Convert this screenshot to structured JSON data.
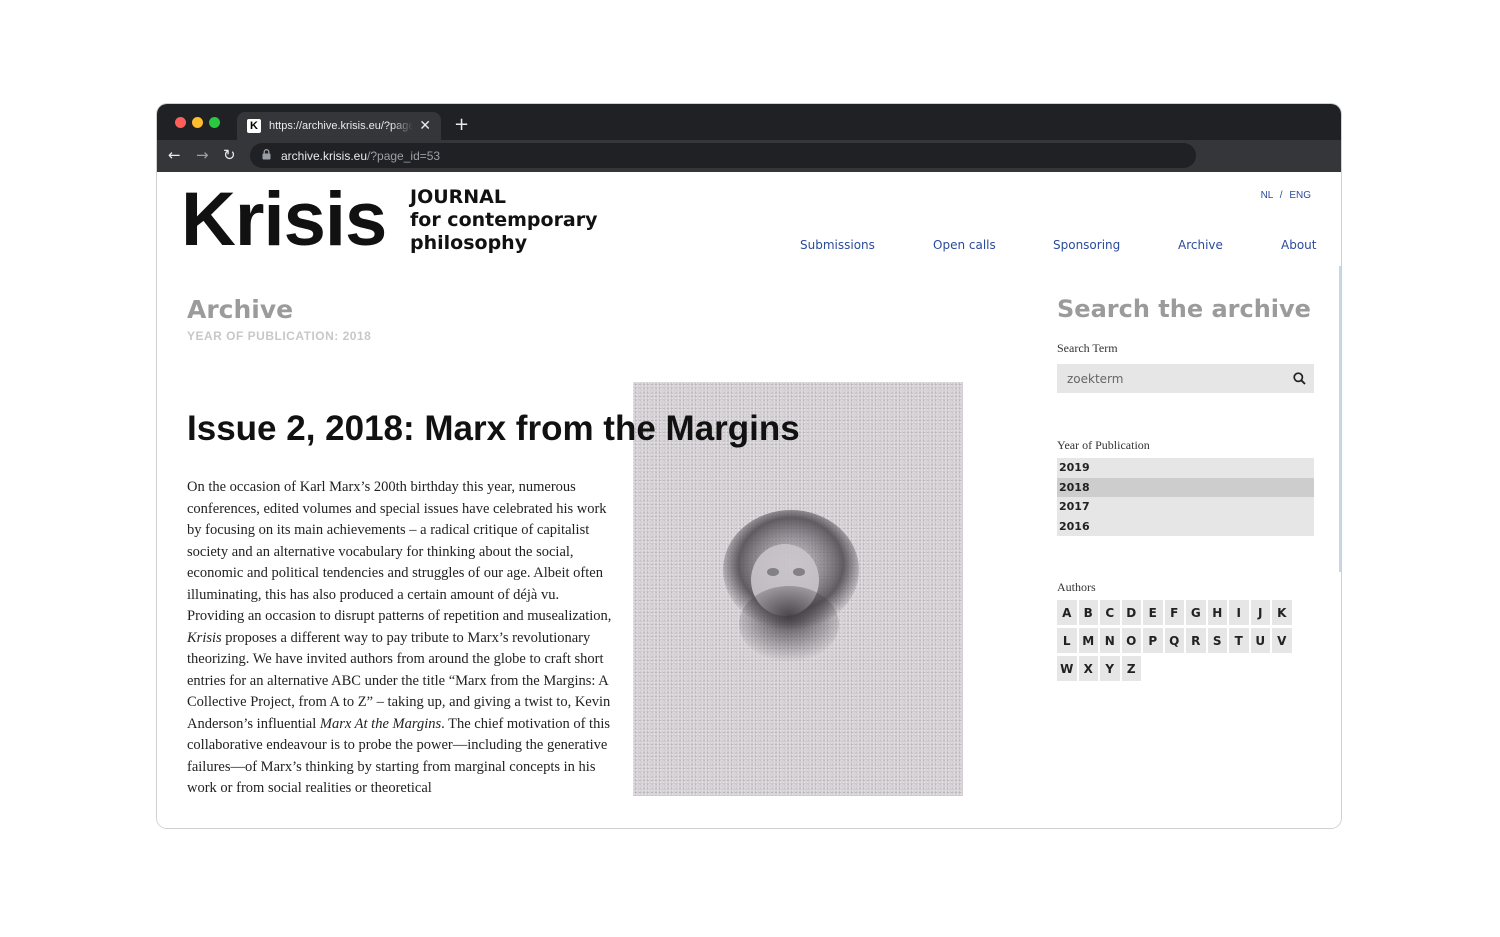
{
  "browser": {
    "tab_favicon": "K",
    "tab_title": "https://archive.krisis.eu/?page_",
    "tab_close": "✕",
    "new_tab": "+",
    "back": "←",
    "forward": "→",
    "reload": "↻",
    "url_host": "archive.krisis.eu",
    "url_path": "/?page_id=53"
  },
  "site": {
    "logo": "Krisis",
    "tagline_lines": [
      "JOURNAL",
      "for contemporary",
      "philosophy"
    ],
    "lang_nl": "NL",
    "lang_sep": "/",
    "lang_eng": "ENG",
    "nav": [
      "Submissions",
      "Open calls",
      "Sponsoring",
      "Archive",
      "About"
    ]
  },
  "main": {
    "title": "Archive",
    "subtitle": "YEAR OF PUBLICATION: 2018",
    "issue_title": "Issue 2, 2018: Marx from the Margins",
    "body_html": "On the occasion of Karl Marx’s 200th birthday this year, numerous conferences, edited volumes and special issues have celebrated his work by focusing on its main achievements – a radical critique of capitalist society and an alternative vocabulary for thinking about the social, economic and political tendencies and struggles of our age. Albeit often illuminating, this has also produced a certain amount of déjà vu. Providing an occasion to disrupt patterns of repetition and musealization, <i>Krisis</i> proposes a different way to pay tribute to Marx’s revolutionary theorizing. We have invited authors from around the globe to craft short entries for an alternative ABC under the title “Marx from the Margins: A Collective Project, from A to Z” – taking up, and giving a twist to, Kevin Anderson’s influential <i>Marx At the Margins</i>. The chief motivation of this collaborative endeavour is to probe the power—including the generative failures—of Marx’s thinking by starting from marginal concepts in his work or from social realities or theoretical"
  },
  "sidebar": {
    "title": "Search the archive",
    "search_label": "Search Term",
    "search_placeholder": "zoekterm",
    "year_label": "Year of Publication",
    "years": [
      "2019",
      "2018",
      "2017",
      "2016"
    ],
    "active_year": "2018",
    "authors_label": "Authors",
    "letters": [
      "A",
      "B",
      "C",
      "D",
      "E",
      "F",
      "G",
      "H",
      "I",
      "J",
      "K",
      "L",
      "M",
      "N",
      "O",
      "P",
      "Q",
      "R",
      "S",
      "T",
      "U",
      "V",
      "W",
      "X",
      "Y",
      "Z"
    ]
  }
}
